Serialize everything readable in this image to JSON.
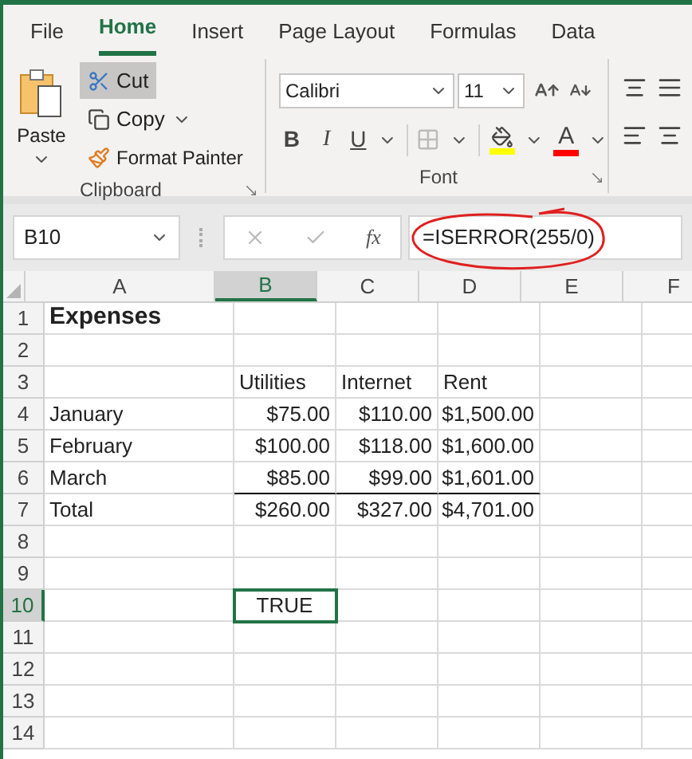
{
  "ribbon_tabs": [
    {
      "label": "File",
      "selected": false
    },
    {
      "label": "Home",
      "selected": true
    },
    {
      "label": "Insert",
      "selected": false
    },
    {
      "label": "Page Layout",
      "selected": false
    },
    {
      "label": "Formulas",
      "selected": false
    },
    {
      "label": "Data",
      "selected": false
    }
  ],
  "clipboard": {
    "paste": "Paste",
    "cut": "Cut",
    "cut_selected": true,
    "copy": "Copy",
    "format_painter": "Format Painter",
    "label": "Clipboard"
  },
  "font": {
    "name": "Calibri",
    "size": "11",
    "bold": "B",
    "italic": "I",
    "underline": "U",
    "font_color_label": "A",
    "label": "Font"
  },
  "formula_bar": {
    "name_box": "B10",
    "function_label": "fx",
    "formula": "=ISERROR(255/0)",
    "annotated": true
  },
  "columns": [
    {
      "label": "A",
      "selected": false
    },
    {
      "label": "B",
      "selected": true
    },
    {
      "label": "C",
      "selected": false
    },
    {
      "label": "D",
      "selected": false
    },
    {
      "label": "E",
      "selected": false
    },
    {
      "label": "F",
      "selected": false
    }
  ],
  "rows": [
    {
      "number": "1",
      "selected": false,
      "col_a": {
        "kind": "title",
        "text": "Expenses",
        "selected": false
      }
    },
    {
      "number": "2",
      "selected": false
    },
    {
      "number": "3",
      "selected": false,
      "col_b": {
        "kind": "text",
        "text": "Utilities",
        "selected": false
      },
      "col_c": {
        "kind": "text",
        "text": "Internet",
        "selected": false
      },
      "col_d": {
        "kind": "text",
        "text": "Rent",
        "selected": false
      }
    },
    {
      "number": "4",
      "selected": false,
      "col_a": {
        "kind": "text",
        "text": "January",
        "selected": false
      },
      "col_b": {
        "kind": "number",
        "text": "$75.00",
        "selected": false
      },
      "col_c": {
        "kind": "number",
        "text": "$110.00",
        "selected": false
      },
      "col_d": {
        "kind": "number",
        "text": "$1,500.00",
        "selected": false
      }
    },
    {
      "number": "5",
      "selected": false,
      "col_a": {
        "kind": "text",
        "text": "February",
        "selected": false
      },
      "col_b": {
        "kind": "number",
        "text": "$100.00",
        "selected": false
      },
      "col_c": {
        "kind": "number",
        "text": "$118.00",
        "selected": false
      },
      "col_d": {
        "kind": "number",
        "text": "$1,600.00",
        "selected": false
      }
    },
    {
      "number": "6",
      "selected": false,
      "col_a": {
        "kind": "text",
        "text": "March",
        "selected": false
      },
      "col_b": {
        "kind": "number",
        "text": "$85.00",
        "selected": false,
        "border_bottom": true
      },
      "col_c": {
        "kind": "number",
        "text": "$99.00",
        "selected": false,
        "border_bottom": true
      },
      "col_d": {
        "kind": "number",
        "text": "$1,601.00",
        "selected": false,
        "border_bottom": true
      }
    },
    {
      "number": "7",
      "selected": false,
      "col_a": {
        "kind": "text",
        "text": "Total",
        "selected": false
      },
      "col_b": {
        "kind": "number",
        "text": "$260.00",
        "selected": false
      },
      "col_c": {
        "kind": "number",
        "text": "$327.00",
        "selected": false
      },
      "col_d": {
        "kind": "number",
        "text": "$4,701.00",
        "selected": false
      }
    },
    {
      "number": "8",
      "selected": false
    },
    {
      "number": "9",
      "selected": false
    },
    {
      "number": "10",
      "selected": true,
      "col_b": {
        "kind": "boolean",
        "text": "TRUE",
        "selected": true
      }
    },
    {
      "number": "11",
      "selected": false
    },
    {
      "number": "12",
      "selected": false
    },
    {
      "number": "13",
      "selected": false
    },
    {
      "number": "14",
      "selected": false
    }
  ]
}
